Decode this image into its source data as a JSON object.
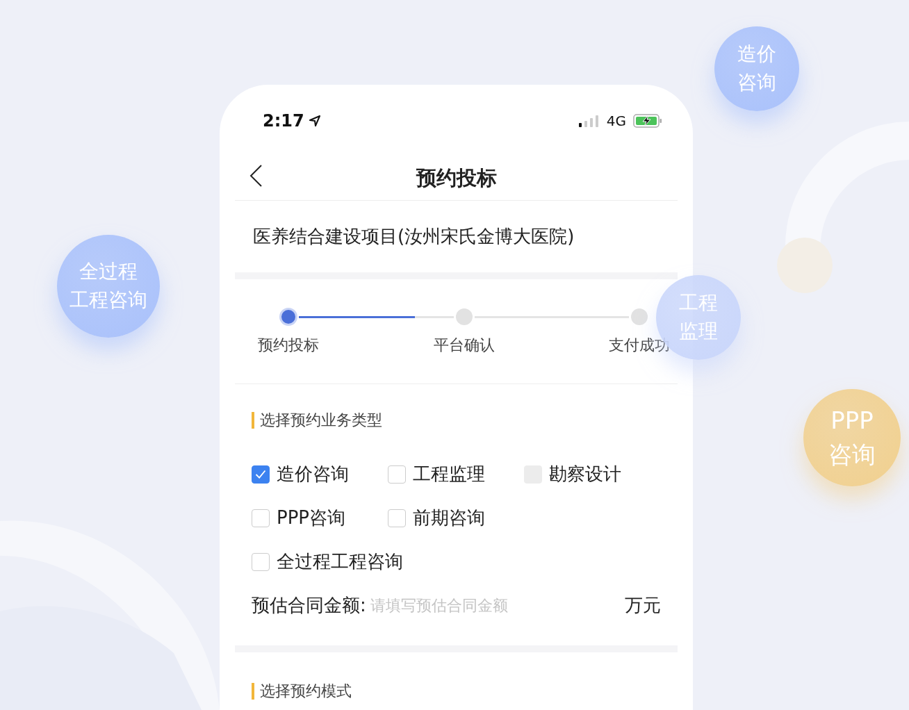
{
  "status_bar": {
    "time": "2:17",
    "network": "4G"
  },
  "nav": {
    "title": "预约投标"
  },
  "project": {
    "name": "医养结合建设项目(汝州宋氏金博大医院)"
  },
  "steps": [
    {
      "label": "预约投标",
      "selected": true
    },
    {
      "label": "平台确认",
      "selected": false
    },
    {
      "label": "支付成功",
      "selected": false
    }
  ],
  "step_connectors": [
    {
      "level": 0.75
    }
  ],
  "business_section": {
    "title": "选择预约业务类型",
    "options": [
      {
        "label": "造价咨询",
        "checked": true,
        "disabled": false
      },
      {
        "label": "工程监理",
        "checked": false,
        "disabled": false
      },
      {
        "label": "勘察设计",
        "checked": false,
        "disabled": true
      },
      {
        "label": "PPP咨询",
        "checked": false,
        "disabled": false
      },
      {
        "label": "前期咨询",
        "checked": false,
        "disabled": false
      },
      {
        "label": "全过程工程咨询",
        "checked": false,
        "disabled": false
      }
    ],
    "amount": {
      "label": "预估合同金额:",
      "placeholder": "请填写预估合同金额",
      "unit": "万元"
    }
  },
  "mode_section": {
    "title": "选择预约模式"
  },
  "bubbles": [
    {
      "lines": [
        "造价",
        "咨询"
      ],
      "color": "#a9c1fb"
    },
    {
      "lines": [
        "全过程",
        "工程咨询"
      ],
      "color": "#a9c1fb"
    },
    {
      "lines": [
        "工程",
        "监理"
      ],
      "color": "#c9d6fb"
    },
    {
      "lines": [
        "PPP",
        "咨询"
      ],
      "color": "#f1d08e"
    }
  ]
}
